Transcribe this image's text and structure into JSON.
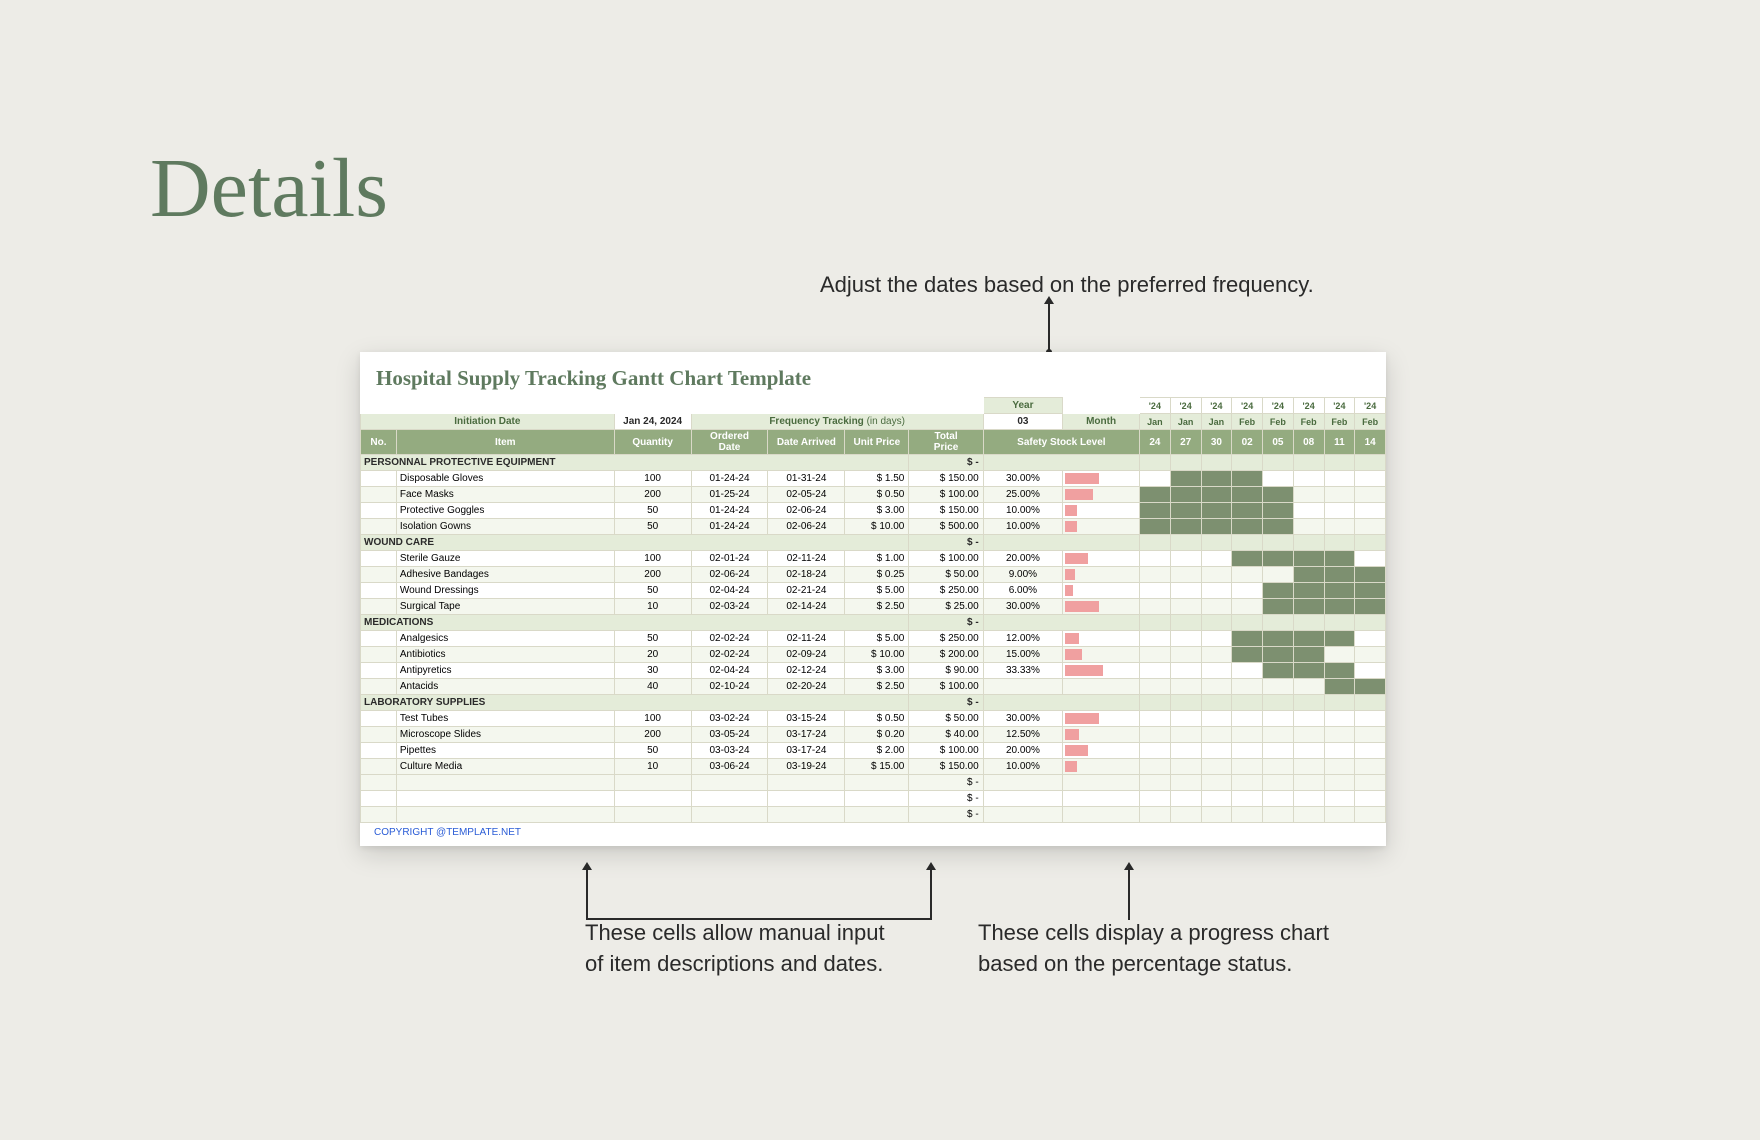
{
  "page": {
    "title": "Details"
  },
  "annotations": {
    "top": "Adjust the dates based on the preferred frequency.",
    "bottom_left_l1": "These cells allow manual input",
    "bottom_left_l2": "of item descriptions and dates.",
    "bottom_right_l1": "These cells display a progress chart",
    "bottom_right_l2": "based on the percentage status."
  },
  "sheet": {
    "title": "Hospital Supply Tracking Gantt Chart Template",
    "year_label": "Year",
    "month_label": "Month",
    "years": [
      "'24",
      "'24",
      "'24",
      "'24",
      "'24",
      "'24",
      "'24",
      "'24"
    ],
    "months": [
      "Jan",
      "Jan",
      "Jan",
      "Feb",
      "Feb",
      "Feb",
      "Feb",
      "Feb"
    ],
    "days": [
      "24",
      "27",
      "30",
      "02",
      "05",
      "08",
      "11",
      "14"
    ],
    "init_date_label": "Initiation Date",
    "init_date_value": "Jan 24, 2024",
    "freq_label": "Frequency Tracking",
    "freq_unit": " (in days)",
    "freq_value": "03",
    "headers": {
      "no": "No.",
      "item": "Item",
      "qty": "Quantity",
      "od": "Ordered Date",
      "da": "Date Arrived",
      "up": "Unit Price",
      "tp": "Total Price",
      "ssl": "Safety Stock Level"
    },
    "categories": [
      {
        "name": "PERSONNAL PROTECTIVE EQUIPMENT",
        "total": "$    -",
        "items": [
          {
            "name": "Disposable Gloves",
            "qty": "100",
            "od": "01-24-24",
            "da": "01-31-24",
            "up": "$    1.50",
            "tp": "$  150.00",
            "ssl": "30.00%",
            "bar": 34,
            "g": [
              0,
              1,
              1,
              1,
              0,
              0,
              0,
              0
            ]
          },
          {
            "name": "Face Masks",
            "qty": "200",
            "od": "01-25-24",
            "da": "02-05-24",
            "up": "$    0.50",
            "tp": "$  100.00",
            "ssl": "25.00%",
            "bar": 28,
            "g": [
              1,
              1,
              1,
              1,
              1,
              0,
              0,
              0
            ]
          },
          {
            "name": "Protective Goggles",
            "qty": "50",
            "od": "01-24-24",
            "da": "02-06-24",
            "up": "$    3.00",
            "tp": "$  150.00",
            "ssl": "10.00%",
            "bar": 12,
            "g": [
              1,
              1,
              1,
              1,
              1,
              0,
              0,
              0
            ]
          },
          {
            "name": "Isolation Gowns",
            "qty": "50",
            "od": "01-24-24",
            "da": "02-06-24",
            "up": "$  10.00",
            "tp": "$  500.00",
            "ssl": "10.00%",
            "bar": 12,
            "g": [
              1,
              1,
              1,
              1,
              1,
              0,
              0,
              0
            ]
          }
        ]
      },
      {
        "name": "WOUND CARE",
        "total": "$    -",
        "items": [
          {
            "name": "Sterile Gauze",
            "qty": "100",
            "od": "02-01-24",
            "da": "02-11-24",
            "up": "$    1.00",
            "tp": "$  100.00",
            "ssl": "20.00%",
            "bar": 23,
            "g": [
              0,
              0,
              0,
              1,
              1,
              1,
              1,
              0
            ]
          },
          {
            "name": "Adhesive Bandages",
            "qty": "200",
            "od": "02-06-24",
            "da": "02-18-24",
            "up": "$    0.25",
            "tp": "$    50.00",
            "ssl": "9.00%",
            "bar": 10,
            "g": [
              0,
              0,
              0,
              0,
              0,
              1,
              1,
              1
            ]
          },
          {
            "name": "Wound Dressings",
            "qty": "50",
            "od": "02-04-24",
            "da": "02-21-24",
            "up": "$    5.00",
            "tp": "$  250.00",
            "ssl": "6.00%",
            "bar": 8,
            "g": [
              0,
              0,
              0,
              0,
              1,
              1,
              1,
              1
            ]
          },
          {
            "name": "Surgical Tape",
            "qty": "10",
            "od": "02-03-24",
            "da": "02-14-24",
            "up": "$    2.50",
            "tp": "$    25.00",
            "ssl": "30.00%",
            "bar": 34,
            "g": [
              0,
              0,
              0,
              0,
              1,
              1,
              1,
              1
            ]
          }
        ]
      },
      {
        "name": "MEDICATIONS",
        "total": "$    -",
        "items": [
          {
            "name": "Analgesics",
            "qty": "50",
            "od": "02-02-24",
            "da": "02-11-24",
            "up": "$    5.00",
            "tp": "$  250.00",
            "ssl": "12.00%",
            "bar": 14,
            "g": [
              0,
              0,
              0,
              1,
              1,
              1,
              1,
              0
            ]
          },
          {
            "name": "Antibiotics",
            "qty": "20",
            "od": "02-02-24",
            "da": "02-09-24",
            "up": "$  10.00",
            "tp": "$  200.00",
            "ssl": "15.00%",
            "bar": 17,
            "g": [
              0,
              0,
              0,
              1,
              1,
              1,
              0,
              0
            ]
          },
          {
            "name": "Antipyretics",
            "qty": "30",
            "od": "02-04-24",
            "da": "02-12-24",
            "up": "$    3.00",
            "tp": "$    90.00",
            "ssl": "33.33%",
            "bar": 38,
            "g": [
              0,
              0,
              0,
              0,
              1,
              1,
              1,
              0
            ]
          },
          {
            "name": "Antacids",
            "qty": "40",
            "od": "02-10-24",
            "da": "02-20-24",
            "up": "$    2.50",
            "tp": "$  100.00",
            "ssl": "",
            "bar": 0,
            "g": [
              0,
              0,
              0,
              0,
              0,
              0,
              1,
              1
            ]
          }
        ]
      },
      {
        "name": "LABORATORY SUPPLIES",
        "total": "$    -",
        "items": [
          {
            "name": "Test Tubes",
            "qty": "100",
            "od": "03-02-24",
            "da": "03-15-24",
            "up": "$    0.50",
            "tp": "$    50.00",
            "ssl": "30.00%",
            "bar": 34,
            "g": [
              0,
              0,
              0,
              0,
              0,
              0,
              0,
              0
            ]
          },
          {
            "name": "Microscope Slides",
            "qty": "200",
            "od": "03-05-24",
            "da": "03-17-24",
            "up": "$    0.20",
            "tp": "$    40.00",
            "ssl": "12.50%",
            "bar": 14,
            "g": [
              0,
              0,
              0,
              0,
              0,
              0,
              0,
              0
            ]
          },
          {
            "name": "Pipettes",
            "qty": "50",
            "od": "03-03-24",
            "da": "03-17-24",
            "up": "$    2.00",
            "tp": "$  100.00",
            "ssl": "20.00%",
            "bar": 23,
            "g": [
              0,
              0,
              0,
              0,
              0,
              0,
              0,
              0
            ]
          },
          {
            "name": "Culture Media",
            "qty": "10",
            "od": "03-06-24",
            "da": "03-19-24",
            "up": "$  15.00",
            "tp": "$  150.00",
            "ssl": "10.00%",
            "bar": 12,
            "g": [
              0,
              0,
              0,
              0,
              0,
              0,
              0,
              0
            ]
          }
        ]
      }
    ],
    "empty_totals": [
      "$    -",
      "$    -",
      "$    -"
    ],
    "copyright": "COPYRIGHT @TEMPLATE.NET"
  }
}
